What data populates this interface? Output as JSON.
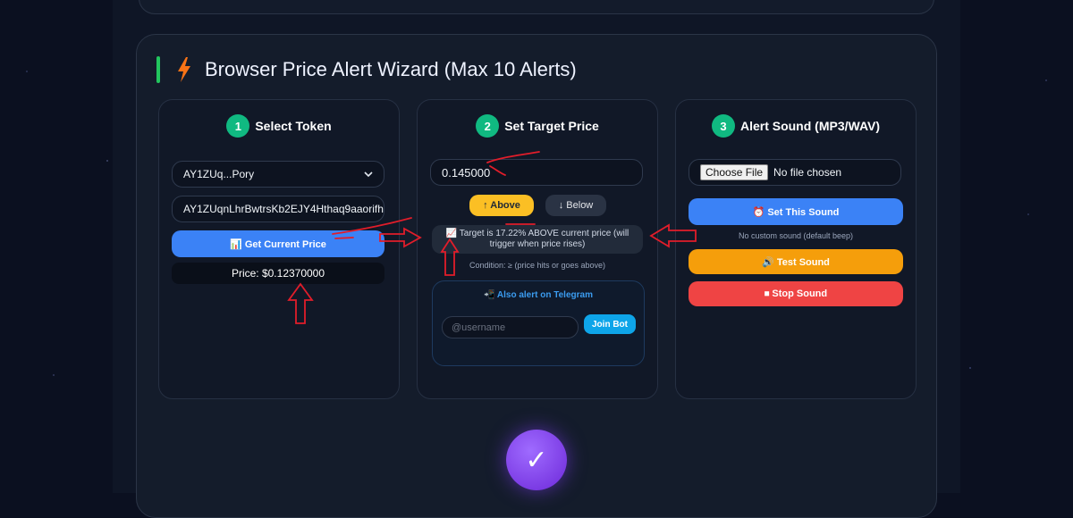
{
  "wizard": {
    "title": "Browser Price Alert Wizard (Max 10 Alerts)"
  },
  "step1": {
    "number": "1",
    "title": "Select Token",
    "token_select_value": "AY1ZUq...Pory",
    "token_address": "AY1ZUqnLhrBwtrsKb2EJY4Hthaq9aaorifh",
    "get_price_label": "📊 Get Current Price",
    "price_text": "Price: $0.12370000"
  },
  "step2": {
    "number": "2",
    "title": "Set Target Price",
    "target_value": "0.145000",
    "above_label": "↑ Above",
    "below_label": "↓ Below",
    "info_line1": "📈 Target is 17.22% ABOVE current price (will",
    "info_line2": "trigger when price rises)",
    "condition": "Condition: ≥ (price hits or goes above)",
    "telegram_label": "📲 Also alert on Telegram",
    "username_placeholder": "@username",
    "join_label": "Join Bot"
  },
  "step3": {
    "number": "3",
    "title": "Alert Sound (MP3/WAV)",
    "choose_file_label": "Choose File",
    "file_status": "No file chosen",
    "set_sound_label": "⏰ Set This Sound",
    "custom_status": "No custom sound (default beep)",
    "test_label": "🔊 Test Sound",
    "stop_label": "⏹ Stop Sound"
  },
  "confirm": {
    "check_glyph": "✓"
  },
  "colors": {
    "accent_green": "#10b981",
    "blue": "#3b82f6",
    "yellow": "#fbbf24",
    "orange": "#f59e0b",
    "red": "#ef4444",
    "purple": "#7c3aed",
    "annotation_red": "#e11d2a"
  }
}
